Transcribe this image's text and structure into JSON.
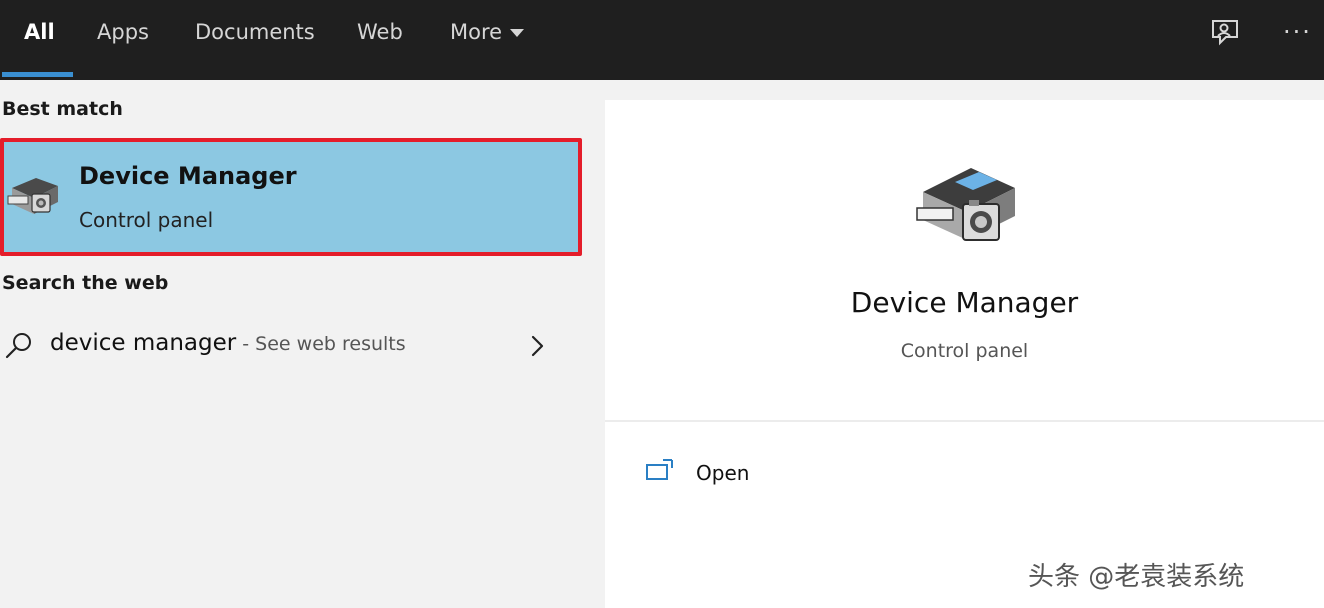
{
  "tabs": [
    {
      "label": "All",
      "active": true
    },
    {
      "label": "Apps"
    },
    {
      "label": "Documents"
    },
    {
      "label": "Web"
    },
    {
      "label": "More"
    }
  ],
  "left": {
    "best_match_label": "Best match",
    "best_match": {
      "title": "Device Manager",
      "subtitle": "Control panel"
    },
    "search_web_label": "Search the web",
    "web_result": {
      "query": "device manager",
      "suffix": " - See web results"
    }
  },
  "right": {
    "title": "Device Manager",
    "subtitle": "Control panel",
    "actions": [
      {
        "label": "Open",
        "icon": "open-window-icon"
      }
    ]
  },
  "watermark": "头条 @老袁装系统",
  "colors": {
    "accent": "#3a8fd1",
    "selection": "#8cc8e2",
    "highlight_border": "#e41d2a",
    "topbar": "#1f1f1f"
  }
}
